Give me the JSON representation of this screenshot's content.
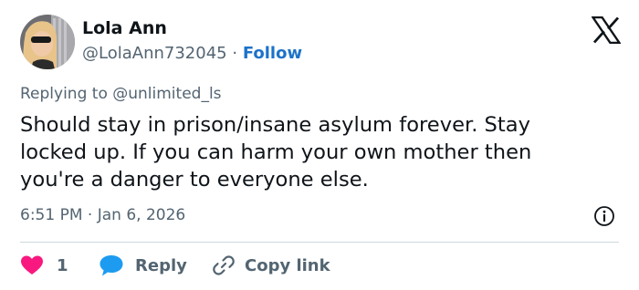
{
  "author": {
    "name": "Lola Ann",
    "handle": "@LolaAnn732045",
    "separator": "·",
    "follow_label": "Follow"
  },
  "reply_context": {
    "prefix": "Replying to",
    "mention": "@unlimited_ls"
  },
  "tweet": {
    "lines": [
      "Should stay in prison/insane asylum forever. Stay",
      "locked up. If you can harm your own mother then",
      "you're a danger to everyone else."
    ]
  },
  "meta": {
    "timestamp": "6:51 PM · Jan 6, 2026"
  },
  "actions": {
    "like_count": "1",
    "reply_label": "Reply",
    "copy_label": "Copy link"
  },
  "icons": {
    "logo": "x-logo-icon",
    "like": "heart-icon",
    "reply": "speech-bubble-icon",
    "copy": "link-icon",
    "info": "info-icon"
  },
  "colors": {
    "like": "#f91880",
    "reply": "#1d9bf0",
    "follow": "#1d72c8",
    "secondary_text": "#536471",
    "primary_text": "#0f1419"
  }
}
